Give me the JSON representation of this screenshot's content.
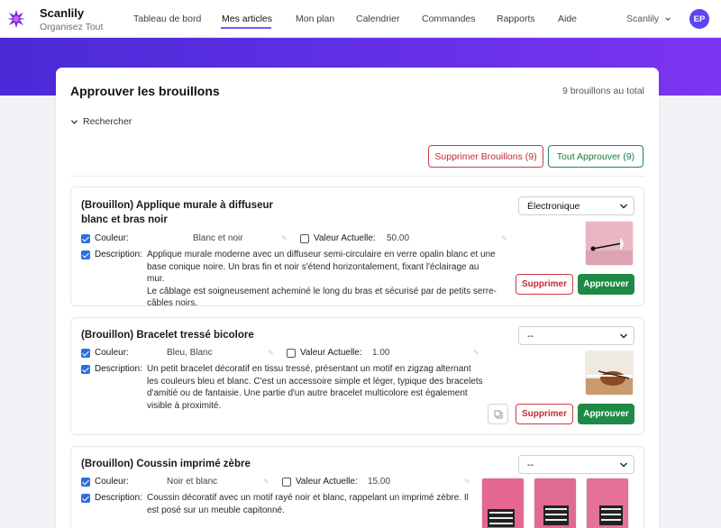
{
  "brand": {
    "name": "Scanlily",
    "tagline": "Organisez Tout"
  },
  "nav": [
    {
      "label": "Tableau de bord"
    },
    {
      "label": "Mes articles",
      "active": true
    },
    {
      "label": "Mon plan"
    },
    {
      "label": "Calendrier"
    },
    {
      "label": "Commandes"
    },
    {
      "label": "Rapports"
    },
    {
      "label": "Aide"
    }
  ],
  "user": {
    "menu_label": "Scanlily",
    "initials": "EP"
  },
  "colors": {
    "accent": "#6a5cf6",
    "band_start": "#4a2ad6",
    "band_end": "#7c35f0",
    "danger": "#c42a33",
    "success": "#1e8a45"
  },
  "page": {
    "title": "Approuver les brouillons",
    "count_text": "9 brouillons au total",
    "search_label": "Rechercher",
    "delete_drafts_label": "Supprimer Brouillons (9)",
    "approve_all_label": "Tout Approuver (9)"
  },
  "labels": {
    "color": "Couleur:",
    "current_value": "Valeur Actuelle:",
    "description": "Description:",
    "delete": "Supprimer",
    "approve": "Approuver"
  },
  "drafts": [
    {
      "title_line1": "(Brouillon) Applique murale à diffuseur",
      "title_line2": "blanc et bras noir",
      "color": "Blanc et noir",
      "value": "50.00",
      "category": "Électronique",
      "description": [
        "Applique murale moderne avec un diffuseur semi-circulaire en verre opalin blanc et une",
        "base conique noire. Un bras fin et noir s'étend horizontalement, fixant l'éclairage au mur.",
        "Le câblage est soigneusement acheminé le long du bras et sécurisé par de petits serre-",
        "câbles noirs."
      ]
    },
    {
      "title_line1": "(Brouillon) Bracelet tressé bicolore",
      "color": "Bleu, Blanc",
      "value": "1.00",
      "category": "--",
      "description": [
        "Un petit bracelet décoratif en tissu tressé, présentant un motif en zigzag alternant",
        "les couleurs bleu et blanc. C'est un accessoire simple et léger, typique des bracelets",
        "d'amitié ou de fantaisie. Une partie d'un autre bracelet multicolore est également",
        "visible à proximité."
      ]
    },
    {
      "title_line1": "(Brouillon) Coussin imprimé zèbre",
      "color": "Noir et blanc",
      "value": "15.00",
      "category": "--",
      "description": [
        "Coussin décoratif avec un motif rayé noir et blanc, rappelant un imprimé zèbre. Il",
        "est posé sur un meuble capitonné."
      ]
    }
  ]
}
